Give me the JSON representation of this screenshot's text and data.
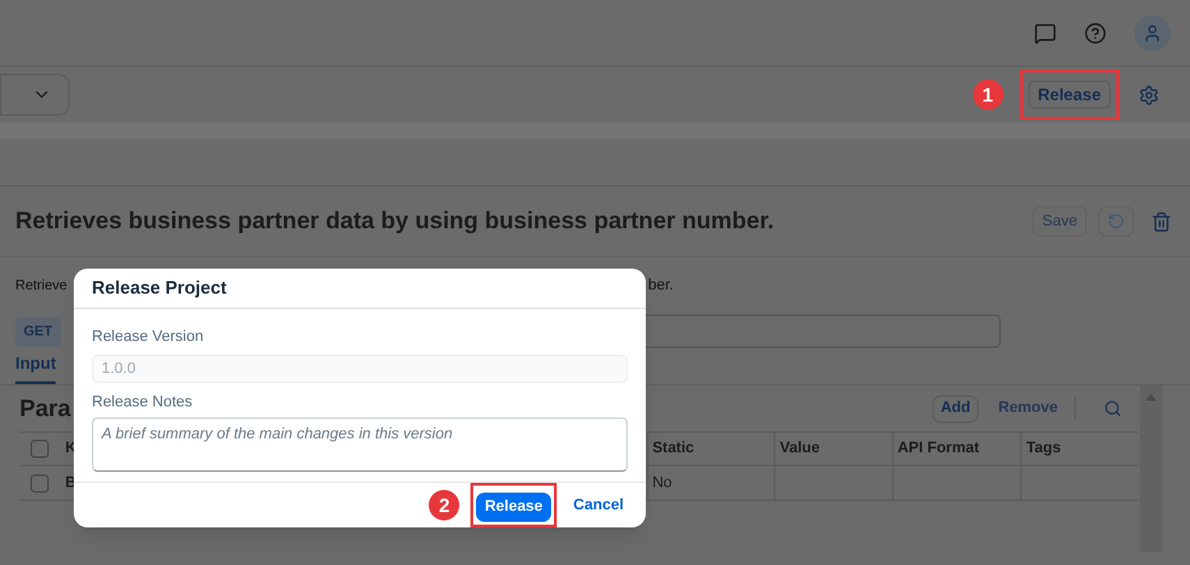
{
  "toolbar": {
    "release_button": {
      "label": "Release",
      "callout": "1"
    }
  },
  "header": {
    "title": "Retrieves business partner data by using business partner number.",
    "save_button": {
      "label": "Save",
      "disabled": true
    }
  },
  "description": {
    "left": "Retrieve",
    "right": "ber."
  },
  "method_badge": "GET",
  "tabs": [
    {
      "label": "Input",
      "selected": true
    }
  ],
  "parameters": {
    "heading": "Para",
    "select_all_checked": false,
    "add_button": {
      "label": "Add",
      "disabled": false
    },
    "remove_button": {
      "label": "Remove",
      "disabled": true
    },
    "table": {
      "columns": [
        "K",
        "Static",
        "Value",
        "API Format",
        "Tags"
      ],
      "rows": [
        {
          "checked": false,
          "cells": [
            "B",
            "No"
          ]
        }
      ]
    }
  },
  "dialog": {
    "title": "Release Project",
    "version_field": {
      "label": "Release Version",
      "value": "1.0.0",
      "disabled": true
    },
    "notes_field": {
      "label": "Release Notes",
      "placeholder": "A brief summary of the main changes in this version"
    },
    "release_button": {
      "label": "Release",
      "callout": "2"
    },
    "cancel_button": {
      "label": "Cancel"
    }
  }
}
